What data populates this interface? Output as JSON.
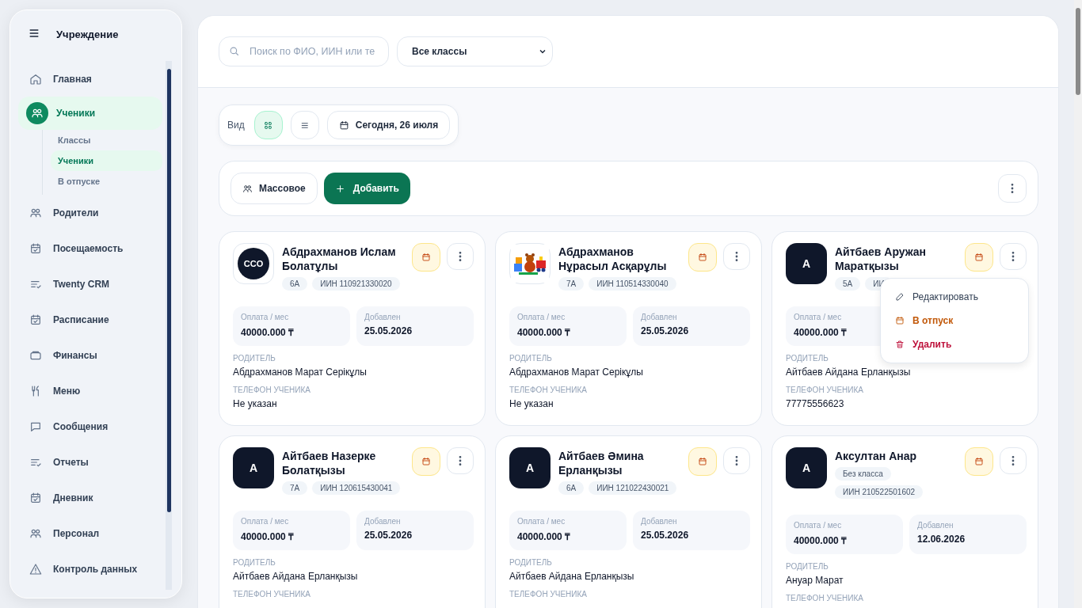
{
  "sidebar": {
    "title": "Учреждение",
    "items": [
      {
        "label": "Главная",
        "kind": "home",
        "selected": false
      },
      {
        "label": "Ученики",
        "kind": "users",
        "selected": true,
        "children": [
          {
            "label": "Классы",
            "selected": false
          },
          {
            "label": "Ученики",
            "selected": true
          },
          {
            "label": "В отпуске",
            "selected": false
          }
        ]
      },
      {
        "label": "Родители",
        "kind": "users",
        "selected": false
      },
      {
        "label": "Посещаемость",
        "kind": "calendar",
        "selected": false
      },
      {
        "label": "Twenty CRM",
        "kind": "list",
        "selected": false
      },
      {
        "label": "Расписание",
        "kind": "calendar",
        "selected": false
      },
      {
        "label": "Финансы",
        "kind": "wallet",
        "selected": false
      },
      {
        "label": "Меню",
        "kind": "utensils",
        "selected": false
      },
      {
        "label": "Сообщения",
        "kind": "chat",
        "selected": false
      },
      {
        "label": "Отчеты",
        "kind": "list",
        "selected": false
      },
      {
        "label": "Дневник",
        "kind": "calendar",
        "selected": false
      },
      {
        "label": "Персонал",
        "kind": "users",
        "selected": false
      },
      {
        "label": "Контроль данных",
        "kind": "warning",
        "selected": false
      }
    ]
  },
  "search": {
    "placeholder": "Поиск по ФИО, ИИН или те"
  },
  "class_filter": {
    "value": "Все классы"
  },
  "view": {
    "label": "Вид",
    "modes": [
      {
        "kind": "grid",
        "selected": true
      },
      {
        "kind": "list",
        "selected": false
      }
    ],
    "date": "Сегодня, 26 июля"
  },
  "actions": {
    "bulk": "Массовое",
    "add": "Добавить"
  },
  "students": [
    {
      "name": "Абдрахманов Ислам Болатұлы",
      "avatar": {
        "kind": "logo",
        "text": "CCO"
      },
      "chips": [
        "6А",
        "ИИН 110921330020"
      ],
      "payment_label": "Оплата / мес",
      "payment": "40000.000 ₸",
      "added_label": "Добавлен",
      "added": "25.05.2026",
      "parent_label": "РОДИТЕЛЬ",
      "parent": "Абдрахманов Марат Серікұлы",
      "phone_label": "ТЕЛЕФОН УЧЕНИКА",
      "phone": "Не указан"
    },
    {
      "name": "Абдрахманов Нұрасыл Асқарұлы",
      "avatar": {
        "kind": "picture"
      },
      "chips": [
        "7А",
        "ИИН 110514330040"
      ],
      "payment_label": "Оплата / мес",
      "payment": "40000.000 ₸",
      "added_label": "Добавлен",
      "added": "25.05.2026",
      "parent_label": "РОДИТЕЛЬ",
      "parent": "Абдрахманов Марат Серікұлы",
      "phone_label": "ТЕЛЕФОН УЧЕНИКА",
      "phone": "Не указан"
    },
    {
      "name": "Айтбаев Аружан Маратқызы",
      "avatar": {
        "kind": "letter",
        "text": "А"
      },
      "chips": [
        "5А",
        "ИИ"
      ],
      "payment_label": "Оплата / мес",
      "payment": "40000.000 ₸",
      "parent_label": "РОДИТЕЛЬ",
      "parent": "Айтбаев Айдана Ерланқызы",
      "phone_label": "ТЕЛЕФОН УЧЕНИКА",
      "phone": "77775556623",
      "menu": [
        {
          "label": "Редактировать",
          "kind": "edit"
        },
        {
          "label": "В отпуск",
          "kind": "vacation"
        },
        {
          "label": "Удалить",
          "kind": "delete"
        }
      ]
    },
    {
      "name": "Айтбаев Назерке Болатқызы",
      "avatar": {
        "kind": "letter",
        "text": "А"
      },
      "chips": [
        "7А",
        "ИИН 120615430041"
      ],
      "payment_label": "Оплата / мес",
      "payment": "40000.000 ₸",
      "added_label": "Добавлен",
      "added": "25.05.2026",
      "parent_label": "РОДИТЕЛЬ",
      "parent": "Айтбаев Айдана Ерланқызы",
      "phone_label": "ТЕЛЕФОН УЧЕНИКА"
    },
    {
      "name": "Айтбаев Әмина Ерланқызы",
      "avatar": {
        "kind": "letter",
        "text": "А"
      },
      "chips": [
        "6А",
        "ИИН 121022430021"
      ],
      "payment_label": "Оплата / мес",
      "payment": "40000.000 ₸",
      "added_label": "Добавлен",
      "added": "25.05.2026",
      "parent_label": "РОДИТЕЛЬ",
      "parent": "Айтбаев Айдана Ерланқызы",
      "phone_label": "ТЕЛЕФОН УЧЕНИКА"
    },
    {
      "name": "Аксултан Анар",
      "avatar": {
        "kind": "letter",
        "text": "А"
      },
      "chips": [
        "Без класса",
        "ИИН 210522501602"
      ],
      "payment_label": "Оплата / мес",
      "payment": "40000.000 ₸",
      "added_label": "Добавлен",
      "added": "12.06.2026",
      "parent_label": "РОДИТЕЛЬ",
      "parent": "Ануар Марат",
      "phone_label": "ТЕЛЕФОН УЧЕНИКА"
    }
  ]
}
